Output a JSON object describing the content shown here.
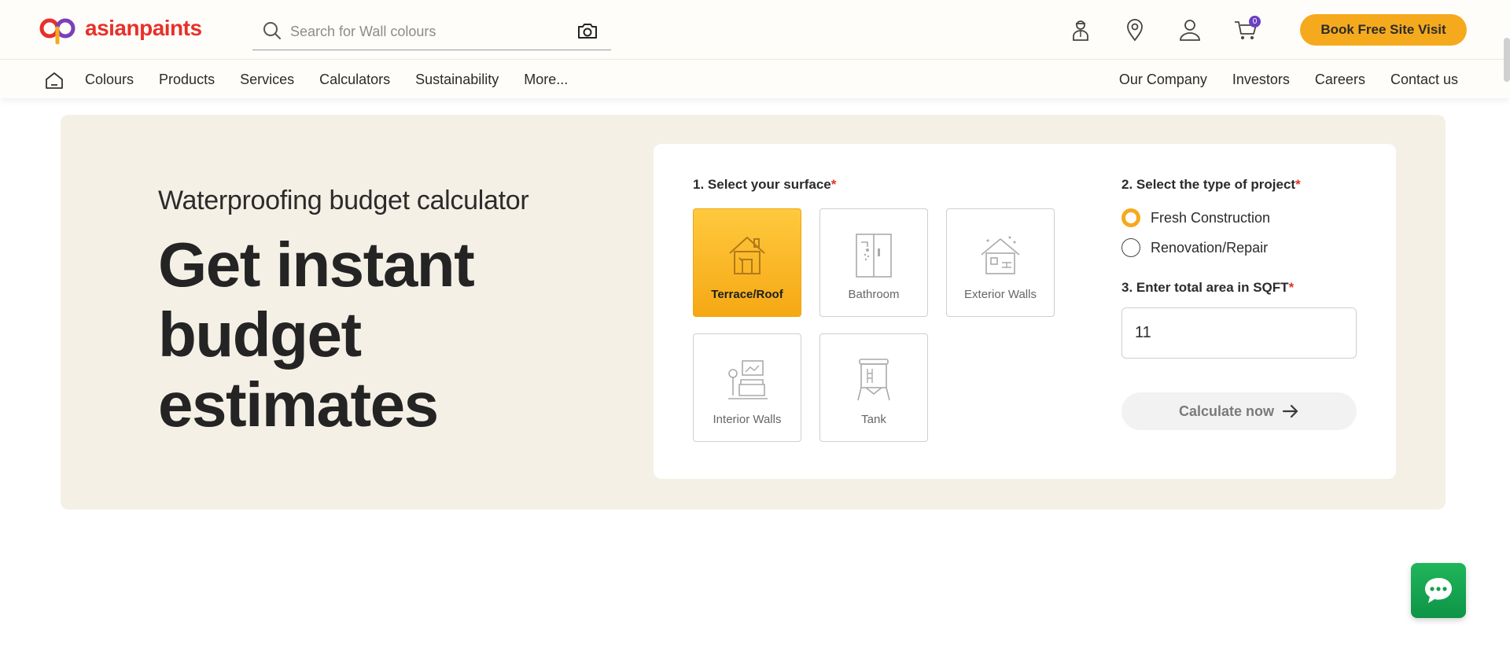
{
  "brand": {
    "name": "asianpaints"
  },
  "search": {
    "placeholder": "Search for Wall colours"
  },
  "header": {
    "cart_count": "0",
    "book_button": "Book Free Site Visit"
  },
  "nav": {
    "left": [
      "Colours",
      "Products",
      "Services",
      "Calculators",
      "Sustainability",
      "More..."
    ],
    "right": [
      "Our Company",
      "Investors",
      "Careers",
      "Contact us"
    ]
  },
  "hero": {
    "subtitle": "Waterproofing budget calculator",
    "title": "Get instant budget estimates"
  },
  "calculator": {
    "step1": {
      "label": "1. Select your surface",
      "required_mark": "*"
    },
    "surfaces": [
      {
        "label": "Terrace/Roof",
        "icon": "house-icon",
        "selected": true
      },
      {
        "label": "Bathroom",
        "icon": "shower-icon",
        "selected": false
      },
      {
        "label": "Exterior Walls",
        "icon": "brick-house-icon",
        "selected": false
      },
      {
        "label": "Interior Walls",
        "icon": "living-room-icon",
        "selected": false
      },
      {
        "label": "Tank",
        "icon": "water-tank-icon",
        "selected": false
      }
    ],
    "step2": {
      "label": "2. Select the type of project",
      "required_mark": "*"
    },
    "project_types": [
      {
        "label": "Fresh Construction",
        "selected": true
      },
      {
        "label": "Renovation/Repair",
        "selected": false
      }
    ],
    "step3": {
      "label": "3. Enter total area in SQFT",
      "required_mark": "*"
    },
    "area_value": "11",
    "calculate_button": "Calculate now"
  },
  "colors": {
    "accent": "#f5aa1e",
    "hero_bg": "#f5f0e6",
    "brand_red": "#e8302a",
    "required": "#e0312a",
    "chat_green": "#1fb65a",
    "badge_purple": "#6a3fc2"
  }
}
